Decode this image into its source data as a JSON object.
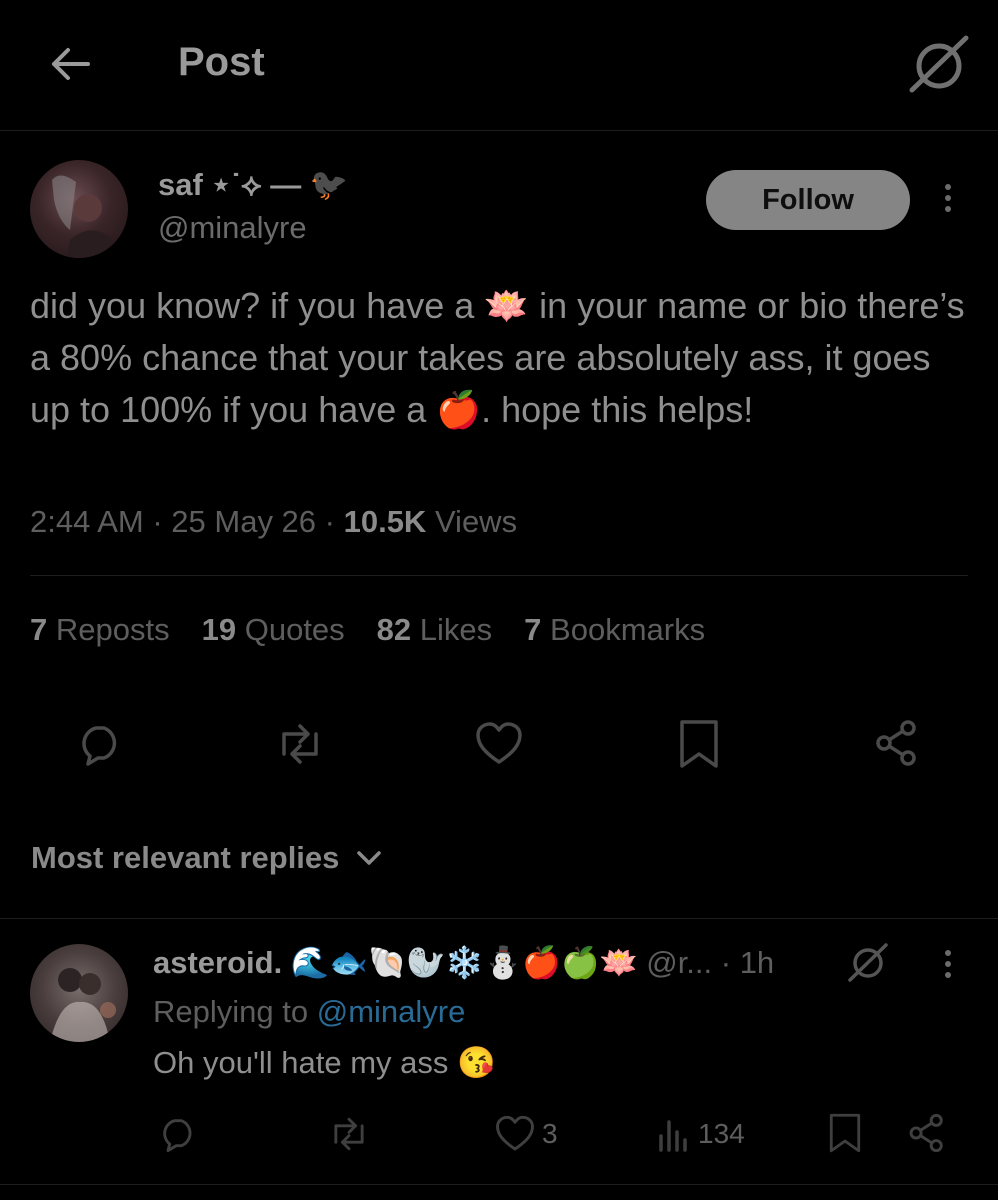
{
  "header": {
    "title": "Post",
    "back_icon": "arrow-left-icon",
    "grok_icon": "grok-icon"
  },
  "post": {
    "author": {
      "name": "saf ⋆˙⟡ — 🐦‍⬛",
      "handle": "@minalyre"
    },
    "follow_label": "Follow",
    "text": "did you know? if you have a 🪷 in your name or bio there’s a 80% chance that your takes are absolutely ass, it goes up to 100% if you have a 🍎. hope this helps!",
    "time": "2:44 AM · 25 May 26 · ",
    "views_count": "10.5K",
    "views_label": " Views",
    "stats": {
      "reposts_count": "7",
      "reposts_label": "Reposts",
      "quotes_count": "19",
      "quotes_label": "Quotes",
      "likes_count": "82",
      "likes_label": "Likes",
      "bookmarks_count": "7",
      "bookmarks_label": "Bookmarks"
    }
  },
  "replies_section": {
    "title": "Most relevant replies"
  },
  "reply": {
    "name": "asteroid. 🌊🐟🐚🦭❄️⛄🍎🍏🪷",
    "handle_time": "@r... · 1h",
    "replying_prefix": "Replying to ",
    "replying_to": "@minalyre",
    "text": "Oh you'll hate my ass 😘",
    "likes": "3",
    "views": "134"
  },
  "colors": {
    "background": "#000000",
    "link": "#2a6b95",
    "follow_bg": "#858585"
  }
}
